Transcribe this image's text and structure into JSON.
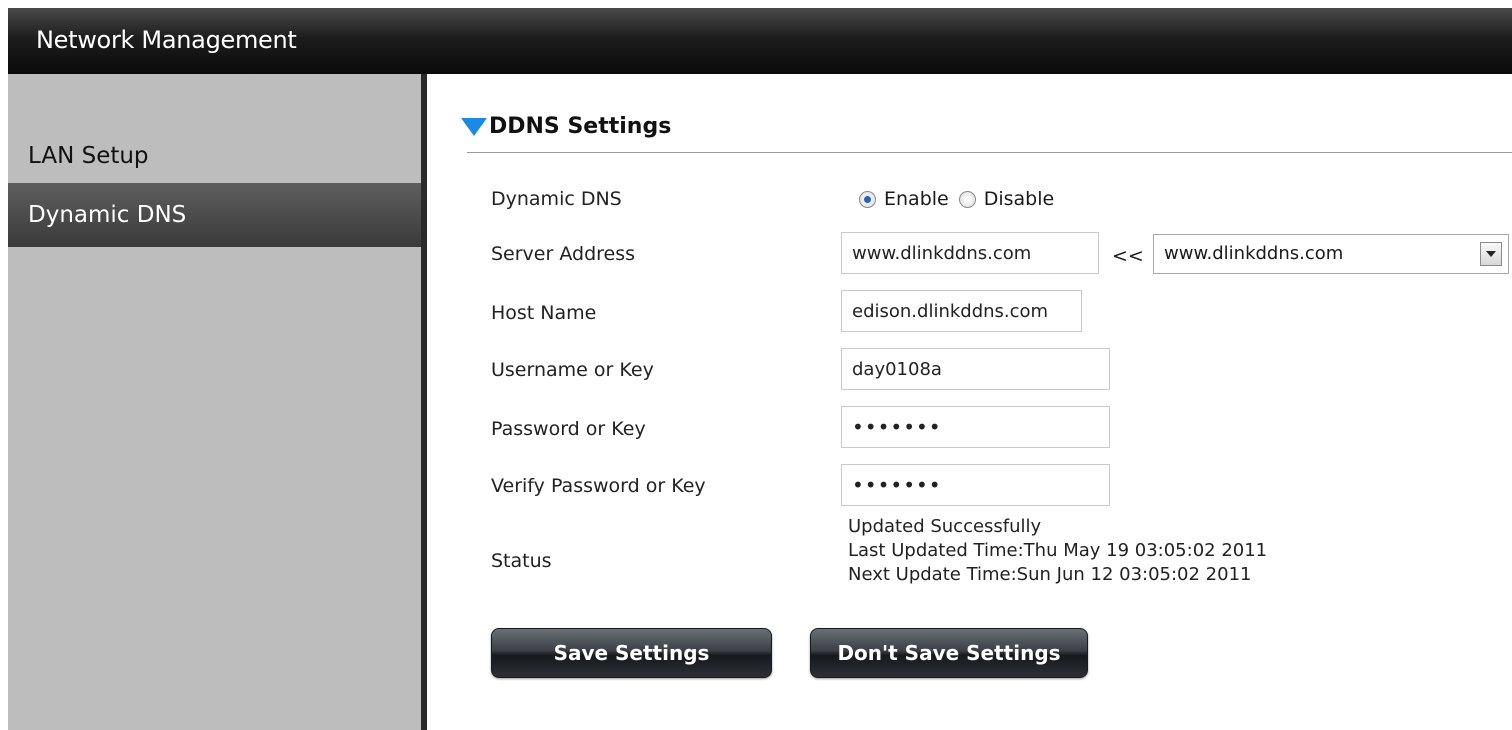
{
  "header": {
    "title": "Network Management"
  },
  "sidebar": {
    "items": [
      {
        "label": "LAN Setup"
      },
      {
        "label": "Dynamic DNS"
      }
    ]
  },
  "section": {
    "title": "DDNS Settings"
  },
  "form": {
    "dynamic_dns": {
      "label": "Dynamic DNS",
      "enable": "Enable",
      "disable": "Disable",
      "selected": "Enable"
    },
    "server_address": {
      "label": "Server Address",
      "value": "www.dlinkddns.com",
      "separator": "<<",
      "select_value": "www.dlinkddns.com"
    },
    "host_name": {
      "label": "Host Name",
      "value": "edison.dlinkddns.com"
    },
    "username": {
      "label": "Username or Key",
      "value": "day0108a"
    },
    "password": {
      "label": "Password or Key",
      "value": "•••••••"
    },
    "verify_password": {
      "label": "Verify Password or Key",
      "value": "•••••••"
    },
    "status": {
      "label": "Status",
      "line1": "Updated Successfully",
      "line2": "Last Updated Time:Thu May 19 03:05:02 2011",
      "line3": "Next Update Time:Sun Jun 12 03:05:02 2011"
    }
  },
  "buttons": {
    "save": "Save Settings",
    "dont_save": "Don't Save Settings"
  },
  "colors": {
    "accent": "#1e88e5",
    "sidebar_active": "#4a4a4a",
    "sidebar_bg": "#bdbdbd"
  }
}
